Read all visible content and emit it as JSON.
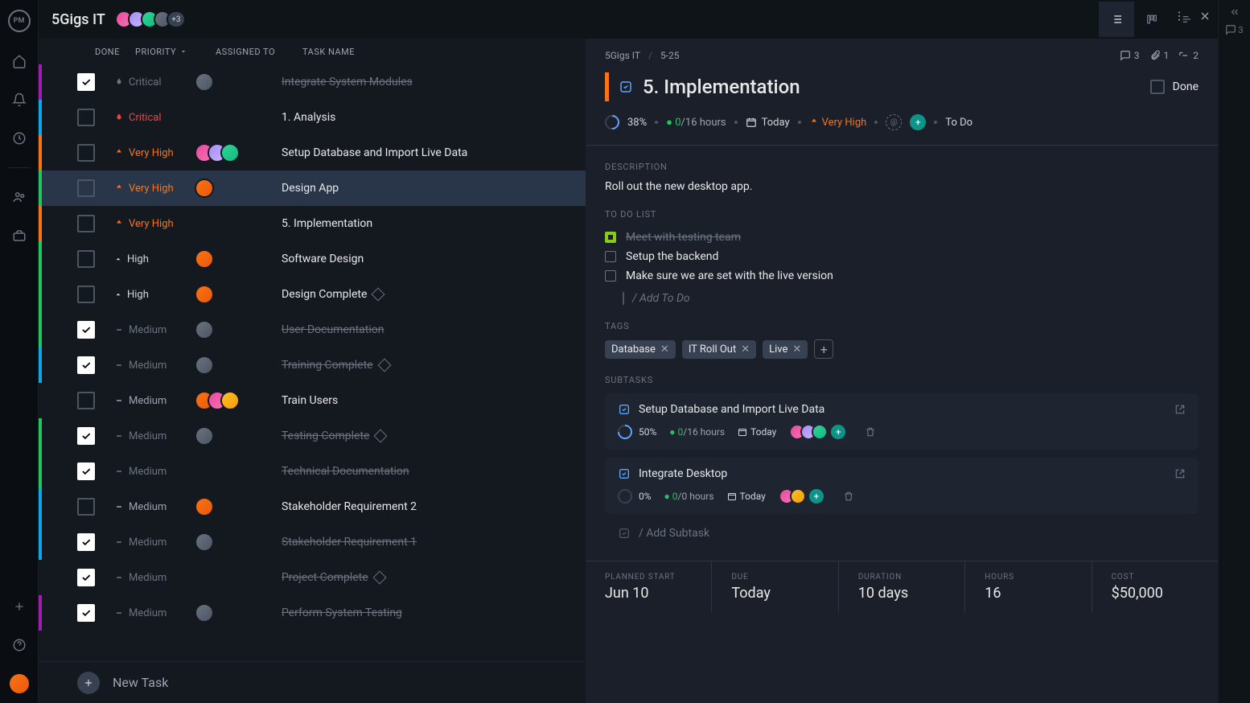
{
  "project": {
    "title": "5Gigs IT",
    "more_avatars": "+3"
  },
  "columns": {
    "done": "DONE",
    "priority": "PRIORITY",
    "assigned": "ASSIGNED TO",
    "task": "TASK NAME"
  },
  "tasks": [
    {
      "bar": "#a21caf",
      "done": true,
      "prio": "Critical",
      "prioClass": "crit dim",
      "avatars": [
        "c4"
      ],
      "name": "Integrate System Modules",
      "completed": true
    },
    {
      "bar": "#0ea5e9",
      "done": false,
      "prio": "Critical",
      "prioClass": "crit",
      "avatars": [],
      "name": "1. Analysis"
    },
    {
      "bar": "#f97316",
      "done": false,
      "prio": "Very High",
      "prioClass": "vhigh",
      "avatars": [
        "c1",
        "c2",
        "c3"
      ],
      "name": "Setup Database and Import Live Data"
    },
    {
      "bar": "#22c55e",
      "done": false,
      "prio": "Very High",
      "prioClass": "vhigh",
      "avatars": [
        "c5"
      ],
      "name": "Design App",
      "selected": true
    },
    {
      "bar": "#f97316",
      "done": false,
      "prio": "Very High",
      "prioClass": "vhigh",
      "avatars": [],
      "name": "5. Implementation"
    },
    {
      "bar": "#22c55e",
      "done": false,
      "prio": "High",
      "prioClass": "high",
      "avatars": [
        "c5"
      ],
      "name": "Software Design"
    },
    {
      "bar": "#22c55e",
      "done": false,
      "prio": "High",
      "prioClass": "high",
      "avatars": [
        "c5"
      ],
      "name": "Design Complete",
      "milestone": true
    },
    {
      "bar": "#22c55e",
      "done": true,
      "prio": "Medium",
      "prioClass": "med dim",
      "avatars": [
        "c4"
      ],
      "name": "User Documentation",
      "completed": true
    },
    {
      "bar": "#0ea5e9",
      "done": true,
      "prio": "Medium",
      "prioClass": "med dim",
      "avatars": [
        "c4"
      ],
      "name": "Training Complete",
      "completed": true,
      "milestone": true
    },
    {
      "bar": "",
      "done": false,
      "prio": "Medium",
      "prioClass": "med",
      "avatars": [
        "c5",
        "c1",
        "c6"
      ],
      "name": "Train Users"
    },
    {
      "bar": "#22c55e",
      "done": true,
      "prio": "Medium",
      "prioClass": "med dim",
      "avatars": [
        "c4"
      ],
      "name": "Testing Complete",
      "completed": true,
      "milestone": true
    },
    {
      "bar": "#22c55e",
      "done": true,
      "prio": "Medium",
      "prioClass": "med dim",
      "avatars": [],
      "name": "Technical Documentation",
      "completed": true
    },
    {
      "bar": "#0ea5e9",
      "done": false,
      "prio": "Medium",
      "prioClass": "med",
      "avatars": [
        "c5"
      ],
      "name": "Stakeholder Requirement 2"
    },
    {
      "bar": "#0ea5e9",
      "done": true,
      "prio": "Medium",
      "prioClass": "med dim",
      "avatars": [
        "c4"
      ],
      "name": "Stakeholder Requirement 1",
      "completed": true
    },
    {
      "bar": "",
      "done": true,
      "prio": "Medium",
      "prioClass": "med dim",
      "avatars": [],
      "name": "Project Complete",
      "completed": true,
      "milestone": true
    },
    {
      "bar": "#a21caf",
      "done": true,
      "prio": "Medium",
      "prioClass": "med dim",
      "avatars": [
        "c4"
      ],
      "name": "Perform System Testing",
      "completed": true
    }
  ],
  "new_task": "New Task",
  "detail": {
    "crumb_project": "5Gigs IT",
    "crumb_id": "5-25",
    "counts": {
      "comments": "3",
      "attach": "1",
      "sub": "2"
    },
    "title": "5. Implementation",
    "done_label": "Done",
    "pct": "38%",
    "hours_done": "0",
    "hours_total": "/16 hours",
    "date": "Today",
    "priority": "Very High",
    "status": "To Do",
    "desc_label": "DESCRIPTION",
    "desc": "Roll out the new desktop app.",
    "todo_label": "TO DO LIST",
    "todos": [
      {
        "done": true,
        "text": "Meet with testing team"
      },
      {
        "done": false,
        "text": "Setup the backend"
      },
      {
        "done": false,
        "text": "Make sure we are set with the live version"
      }
    ],
    "todo_add": "/ Add To Do",
    "tags_label": "TAGS",
    "tags": [
      "Database",
      "IT Roll Out",
      "Live"
    ],
    "subtasks_label": "SUBTASKS",
    "subtasks": [
      {
        "name": "Setup Database and Import Live Data",
        "pct": "50%",
        "hours_done": "0",
        "hours_total": "/16 hours",
        "date": "Today",
        "avatars": [
          "c1",
          "c2",
          "c3"
        ]
      },
      {
        "name": "Integrate Desktop",
        "pct": "0%",
        "hours_done": "0",
        "hours_total": "/0 hours",
        "date": "Today",
        "avatars": [
          "c1",
          "c6"
        ]
      }
    ],
    "add_subtask": "/ Add Subtask",
    "footer": {
      "planned_label": "PLANNED START",
      "planned": "Jun 10",
      "due_label": "DUE",
      "due": "Today",
      "duration_label": "DURATION",
      "duration": "10 days",
      "hours_label": "HOURS",
      "hours": "16",
      "cost_label": "COST",
      "cost": "$50,000"
    }
  },
  "rightrail": {
    "comments": "3"
  }
}
